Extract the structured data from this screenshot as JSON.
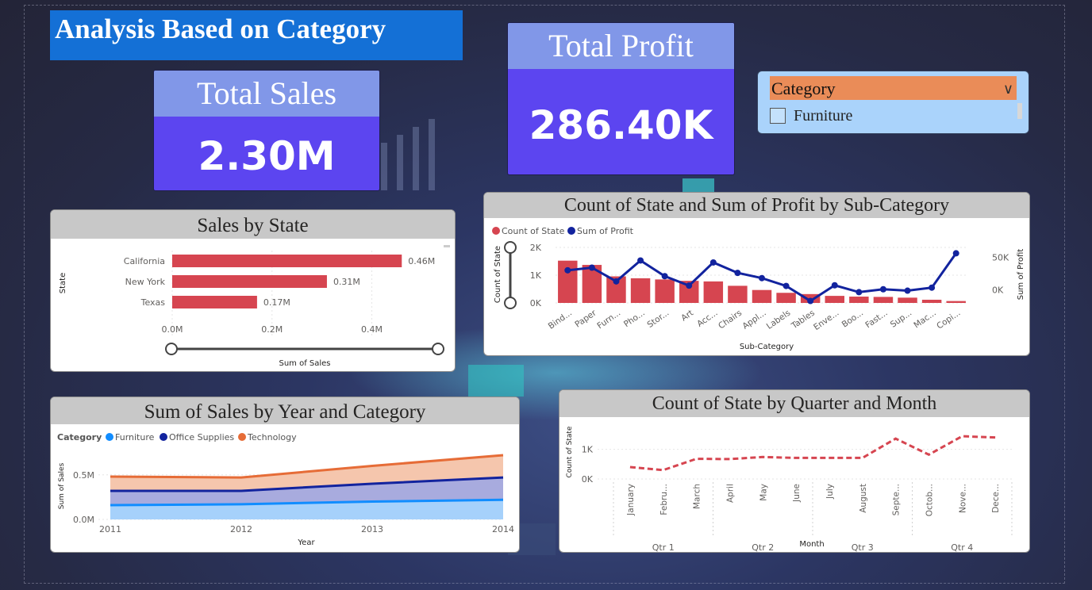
{
  "page_title": "Analysis Based on Category",
  "kpis": {
    "total_sales": {
      "label": "Total Sales",
      "value": "2.30M"
    },
    "total_profit": {
      "label": "Total Profit",
      "value": "286.40K"
    }
  },
  "slicer": {
    "header": "Category",
    "items": [
      {
        "label": "Furniture",
        "checked": false
      }
    ]
  },
  "colors": {
    "title_bg": "#1470d6",
    "kpi_head": "#8197e8",
    "kpi_body": "#5c45f0",
    "slicer_bg": "#aad3fb",
    "slicer_head": "#ea8c58",
    "bar_red": "#d64550",
    "navy": "#12239e",
    "furniture": "#118dff",
    "office_supplies": "#12239e",
    "technology": "#e66c37"
  },
  "chart_data": [
    {
      "id": "sales_by_state",
      "type": "bar",
      "orientation": "horizontal",
      "title": "Sales by State",
      "xlabel": "Sum of Sales",
      "ylabel": "State",
      "categories": [
        "California",
        "New York",
        "Texas"
      ],
      "values": [
        0.46,
        0.31,
        0.17
      ],
      "data_labels": [
        "0.46M",
        "0.31M",
        "0.17M"
      ],
      "xticks": [
        "0.0M",
        "0.2M",
        "0.4M"
      ],
      "xlim": [
        0,
        0.52
      ],
      "grid": true
    },
    {
      "id": "state_profit_by_subcategory",
      "type": "bar",
      "title": "Count of State and Sum of Profit by Sub-Category",
      "legend": [
        "Count of State",
        "Sum of Profit"
      ],
      "xlabel": "Sub-Category",
      "ylabel": "Count of State",
      "ylabel_right": "Sum of Profit",
      "categories": [
        "Bind...",
        "Paper",
        "Furn...",
        "Pho...",
        "Stor...",
        "Art",
        "Acc...",
        "Chairs",
        "Appl...",
        "Labels",
        "Tables",
        "Enve...",
        "Boo...",
        "Fast...",
        "Sup...",
        "Mac...",
        "Copi..."
      ],
      "series": [
        {
          "name": "Count of State",
          "kind": "bar",
          "values": [
            1523,
            1370,
            957,
            889,
            846,
            796,
            775,
            617,
            466,
            364,
            319,
            254,
            228,
            217,
            190,
            115,
            68
          ]
        },
        {
          "name": "Sum of Profit",
          "kind": "line",
          "axis": "right",
          "values": [
            30000,
            34000,
            13000,
            45000,
            21000,
            6500,
            42000,
            26000,
            18000,
            6000,
            -17000,
            7000,
            -3500,
            950,
            -1200,
            3400,
            56000
          ]
        }
      ],
      "yticks_left": [
        "0K",
        "1K",
        "2K"
      ],
      "ylim_left": [
        0,
        2000
      ],
      "yticks_right": [
        "0K",
        "50K"
      ],
      "ylim_right": [
        -20000,
        65000
      ]
    },
    {
      "id": "sales_by_year_category",
      "type": "area",
      "title": "Sum of Sales by Year and Category",
      "legend_title": "Category",
      "legend": [
        "Furniture",
        "Office Supplies",
        "Technology"
      ],
      "xlabel": "Year",
      "ylabel": "Sum of Sales",
      "x": [
        "2011",
        "2012",
        "2013",
        "2014"
      ],
      "series": [
        {
          "name": "Furniture",
          "values": [
            0.16,
            0.17,
            0.2,
            0.22
          ]
        },
        {
          "name": "Office Supplies",
          "values": [
            0.32,
            0.32,
            0.4,
            0.47
          ]
        },
        {
          "name": "Technology",
          "values": [
            0.48,
            0.47,
            0.6,
            0.72
          ]
        }
      ],
      "yticks": [
        "0.0M",
        "0.5M"
      ],
      "ylim": [
        0,
        0.8
      ]
    },
    {
      "id": "state_by_quarter_month",
      "type": "line",
      "title": "Count of State by Quarter and Month",
      "xlabel": "Month",
      "ylabel": "Count of State",
      "x": [
        "January",
        "Febru...",
        "March",
        "April",
        "May",
        "June",
        "July",
        "August",
        "Septe...",
        "Octob...",
        "Nove...",
        "Dece..."
      ],
      "groups": [
        "Qtr 1",
        "Qtr 2",
        "Qtr 3",
        "Qtr 4"
      ],
      "series": [
        {
          "name": "Count of State",
          "values": [
            400,
            300,
            680,
            670,
            740,
            710,
            710,
            710,
            1360,
            820,
            1440,
            1400
          ]
        }
      ],
      "yticks": [
        "0K",
        "1K"
      ],
      "ylim": [
        0,
        1550
      ]
    }
  ]
}
